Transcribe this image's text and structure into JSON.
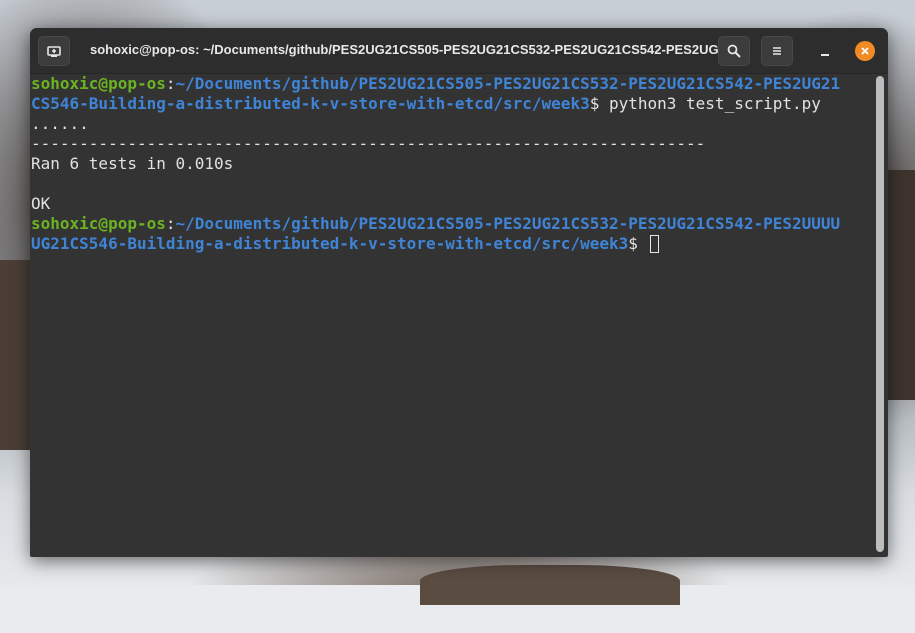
{
  "window": {
    "title": "sohoxic@pop-os: ~/Documents/github/PES2UG21CS505-PES2UG21CS532-PES2UG21CS542-PES2UG..."
  },
  "icons": {
    "new_tab": "new-tab-icon",
    "search": "search-icon",
    "menu": "hamburger-menu-icon",
    "minimize": "minimize-icon",
    "close": "close-icon"
  },
  "colors": {
    "user": "#6bb322",
    "path": "#3f84d6",
    "close_button": "#f28b26",
    "terminal_bg": "#333333"
  },
  "terminal": {
    "prompt1": {
      "user": "sohoxic@pop-os",
      "colon": ":",
      "path_line1": "~/Documents/github/PES2UG21CS505-PES2UG21CS532-PES2UG21CS542-PES2UG21",
      "path_line2": "CS546-Building-a-distributed-k-v-store-with-etcd/src/week3",
      "symbol": "$ ",
      "command": "python3 test_script.py"
    },
    "output": {
      "dots": "......",
      "separator": "----------------------------------------------------------------------",
      "ran": "Ran 6 tests in 0.010s",
      "blank": "",
      "ok": "OK"
    },
    "prompt2": {
      "user": "sohoxic@pop-os",
      "colon": ":",
      "path_line1": "~/Documents/github/PES2UG21CS505-PES2UG21CS532-PES2UG21CS542-PES2UUUU",
      "path_line2": "UG21CS546-Building-a-distributed-k-v-store-with-etcd/src/week3",
      "symbol": "$ "
    }
  }
}
